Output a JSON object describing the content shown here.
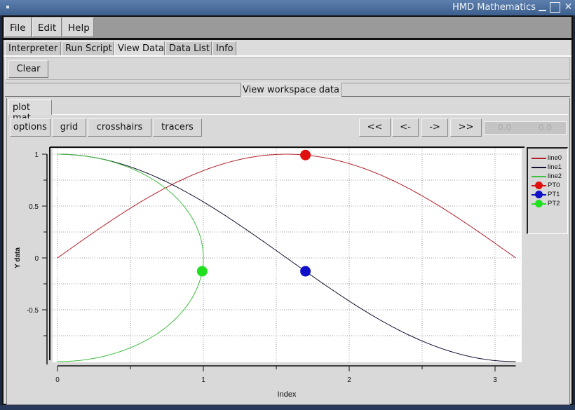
{
  "window": {
    "title": "HMD Mathematics",
    "controls": [
      "minimize",
      "maximize",
      "close"
    ]
  },
  "menubar": {
    "items": [
      {
        "label": "File"
      },
      {
        "label": "Edit"
      },
      {
        "label": "Help"
      }
    ]
  },
  "tabs": [
    {
      "label": "Interpreter",
      "active": false
    },
    {
      "label": "Run Script",
      "active": false
    },
    {
      "label": "View Data",
      "active": true
    },
    {
      "label": "Data List",
      "active": false
    },
    {
      "label": "Info",
      "active": false
    }
  ],
  "toolbar": {
    "clear_label": "Clear"
  },
  "view_header": {
    "label": "View workspace data"
  },
  "plot_tab": {
    "label": "plot mat"
  },
  "plot_toolbar": {
    "options_label": "options",
    "grid_label": "grid",
    "crosshairs_label": "crosshairs",
    "tracers_label": "tracers",
    "first_label": "<<",
    "prev_label": "<-",
    "next_label": "->",
    "last_label": ">>",
    "coord_x": "0.0",
    "coord_y": "0.0"
  },
  "colors": {
    "line0": "#b0202a",
    "line1": "#101030",
    "line2": "#3fbf3f",
    "PT0": "#e01010",
    "PT1": "#1010c8",
    "PT2": "#20e020"
  },
  "chart_data": {
    "type": "line",
    "title": "",
    "xlabel": "Index",
    "ylabel": "Y data",
    "xlim": [
      0,
      3.1416
    ],
    "ylim": [
      -1,
      1
    ],
    "grid": true,
    "legend_position": "right",
    "x_ticks": [
      0,
      1,
      2,
      3
    ],
    "x_tick_labels": [
      "0",
      "1",
      "2",
      "3"
    ],
    "x_minor_ticks": [
      0.5,
      1.5,
      2.5
    ],
    "y_ticks": [
      1,
      0.5,
      0,
      -0.5
    ],
    "y_tick_labels": [
      "1",
      "0.5",
      "0",
      "-0.5"
    ],
    "y_minor_ticks": [
      0.75,
      0.25,
      -0.25,
      -0.75
    ],
    "series": [
      {
        "name": "line0",
        "kind": "line",
        "function": "y = sin(x), x in [0, pi]",
        "x": [
          0,
          0.2618,
          0.5236,
          0.7854,
          1.0472,
          1.309,
          1.5708,
          1.8326,
          2.0944,
          2.3562,
          2.618,
          2.8798,
          3.1416
        ],
        "y": [
          0,
          0.2588,
          0.5,
          0.7071,
          0.866,
          0.9659,
          1,
          0.9659,
          0.866,
          0.7071,
          0.5,
          0.2588,
          0
        ]
      },
      {
        "name": "line1",
        "kind": "line",
        "function": "y = cos(x), x in [0, pi]",
        "x": [
          0,
          0.2618,
          0.5236,
          0.7854,
          1.0472,
          1.309,
          1.5708,
          1.8326,
          2.0944,
          2.3562,
          2.618,
          2.8798,
          3.1416
        ],
        "y": [
          1,
          0.9659,
          0.866,
          0.7071,
          0.5,
          0.2588,
          0,
          -0.2588,
          -0.5,
          -0.7071,
          -0.866,
          -0.9659,
          -1
        ]
      },
      {
        "name": "line2",
        "kind": "line",
        "function": "x = sin(t), y = cos(t), t in [0, pi]",
        "x": [
          0,
          0.2588,
          0.5,
          0.7071,
          0.866,
          0.9659,
          1,
          0.9659,
          0.866,
          0.7071,
          0.5,
          0.2588,
          0
        ],
        "y": [
          1,
          0.9659,
          0.866,
          0.7071,
          0.5,
          0.2588,
          0,
          -0.2588,
          -0.5,
          -0.7071,
          -0.866,
          -0.9659,
          -1
        ]
      },
      {
        "name": "PT0",
        "kind": "point",
        "x": [
          1.7
        ],
        "y": [
          0.9917
        ]
      },
      {
        "name": "PT1",
        "kind": "point",
        "x": [
          1.7
        ],
        "y": [
          -0.1288
        ]
      },
      {
        "name": "PT2",
        "kind": "point",
        "x": [
          0.9917
        ],
        "y": [
          -0.1288
        ]
      }
    ]
  }
}
